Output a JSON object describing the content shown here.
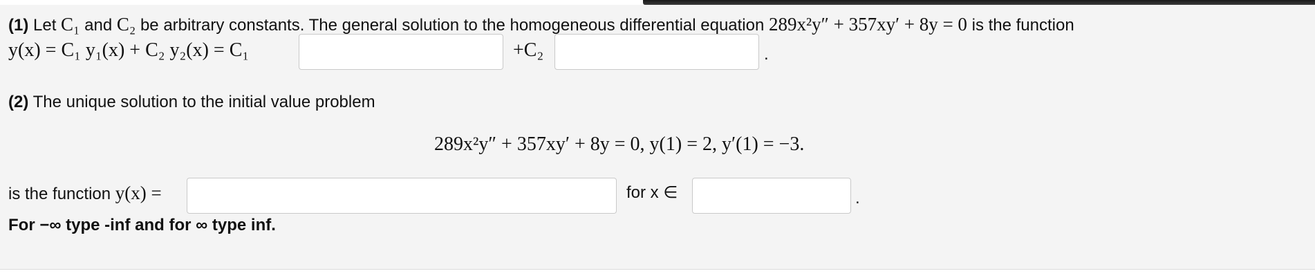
{
  "window": {
    "top_bar_color": "#2a2a2a"
  },
  "part1": {
    "label": "(1)",
    "text_before": " Let ",
    "c1": "C₁",
    "text_and": " and ",
    "c2": "C₂",
    "text_middle": " be arbitrary constants. The general solution to the homogeneous differential equation ",
    "equation": "289x²y″ + 357xy′ + 8y = 0",
    "text_after": " is the function",
    "solution_prefix": "y(x) = C₁ y₁(x) + C₂ y₂(x) = C₁",
    "plus_c2": "+C₂",
    "end_period": ".",
    "input_y1": {
      "value": ""
    },
    "input_y2": {
      "value": ""
    }
  },
  "part2": {
    "label": "(2)",
    "intro": " The unique solution to the initial value problem",
    "ivp": "289x²y″ + 357xy′ + 8y = 0,  y(1) = 2,  y′(1) = −3.",
    "is_function": "is the function ",
    "y_of_x": "y(x) =",
    "for_x_in": "for x ∈",
    "end_period": ".",
    "input_solution": {
      "value": ""
    },
    "input_interval": {
      "value": ""
    },
    "hint": "For −∞ type -inf and for ∞ type inf."
  }
}
